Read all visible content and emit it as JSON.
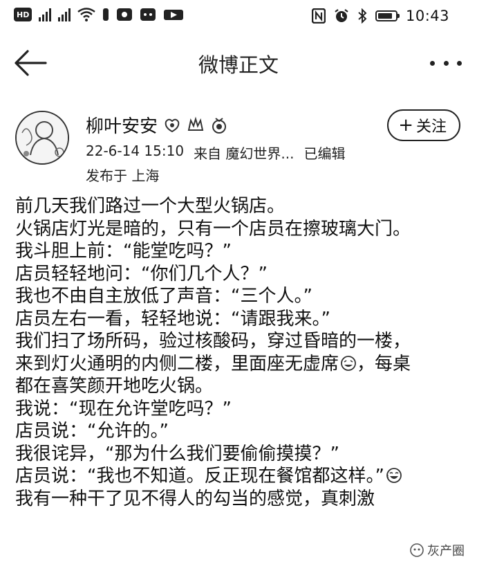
{
  "status_bar": {
    "left_badges": [
      "HD",
      "4G",
      "HD"
    ],
    "time": "10:43",
    "icons": [
      "hd-badge-icon",
      "signal-icon",
      "wifi-icon",
      "notification-icon",
      "nfc-icon",
      "alarm-icon",
      "bluetooth-icon",
      "battery-icon"
    ]
  },
  "header": {
    "title": "微博正文",
    "back_icon": "back-arrow-icon",
    "more_icon": "more-dots-icon"
  },
  "post": {
    "author": "柳叶安安",
    "badges": [
      "vip-badge-icon",
      "fan-badge-icon",
      "medal-badge-icon"
    ],
    "follow_label": "关注",
    "follow_plus": "+",
    "date": "22-6-14 15:10",
    "source": "来自 魔幻世界...",
    "edited": "已编辑",
    "location": "发布于 上海",
    "lines": [
      "前几天我们路过一个大型火锅店。",
      "火锅店灯光是暗的，只有一个店员在擦玻璃大门。",
      "我斗胆上前：“能堂吃吗？”",
      "店员轻轻地问：“你们几个人？”",
      "我也不由自主放低了声音：“三个人。”",
      "店员左右一看，轻轻地说：“请跟我来。”",
      "我们扫了场所码，验过核酸码，穿过昏暗的一楼，",
      "来到灯火通明的内侧二楼，里面座无虚席",
      "都在喜笑颜开地吃火锅。",
      "我说：“现在允许堂吃吗？”",
      "店员说：“允许的。”",
      "我很诧异，“那为什么我们要偷偷摸摸？”",
      "店员说：“我也不知道。反正现在餐馆都这样。”",
      "我有一种干了见不得人的勾当的感觉，真刺激"
    ],
    "line8_suffix": "，每桌"
  },
  "watermark": {
    "text": "灰产圈"
  }
}
